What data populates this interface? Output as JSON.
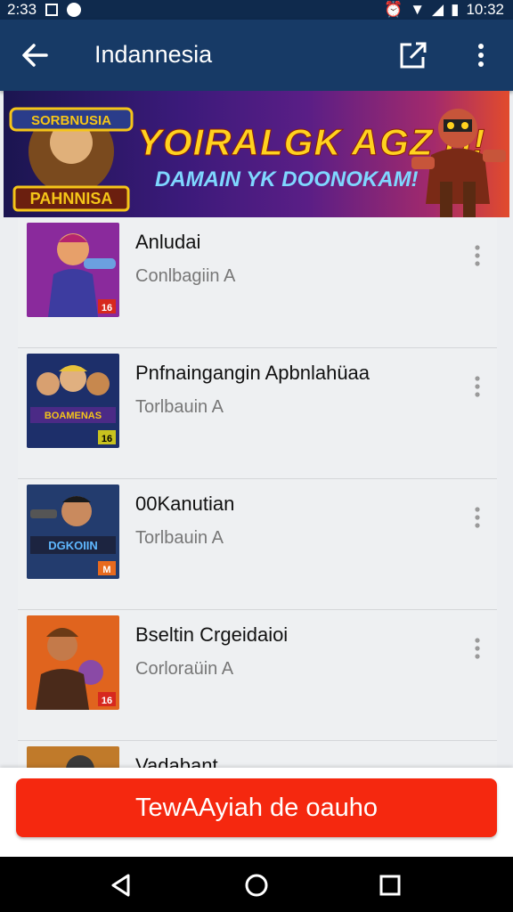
{
  "status_bar": {
    "left_time": "2:33",
    "right_time": "10:32"
  },
  "app_bar": {
    "title": "Indannesia"
  },
  "banner": {
    "logo_text": "SORBNUSIA PAHNNISA",
    "headline": "YOIRALGK AGZ H!",
    "subheadline": "DAMAIN YK DOONOKAM!"
  },
  "list": {
    "items": [
      {
        "title": "Anludai",
        "subtitle": "Conlbagiin A",
        "thumb_badge": "16"
      },
      {
        "title": "Pnfnaingangin Apbnlahüaa",
        "subtitle": "Torlbauin A",
        "thumb_badge": "16",
        "thumb_text": "BOAMENAS"
      },
      {
        "title": "00Kanutian",
        "subtitle": "Torlbauin A",
        "thumb_badge": "M",
        "thumb_text": "DGKOIIN"
      },
      {
        "title": "Bseltin Crgeidaioi",
        "subtitle": "Corloraüin A",
        "thumb_badge": "16"
      },
      {
        "title": "Vadabant",
        "subtitle": "",
        "thumb_badge": ""
      }
    ]
  },
  "cta": {
    "label": "TewAAyiah de oauho"
  },
  "colors": {
    "app_bar": "#173a66",
    "status_bar": "#0f2a4d",
    "cta": "#f5280f",
    "list_bg": "#eef0f2"
  }
}
